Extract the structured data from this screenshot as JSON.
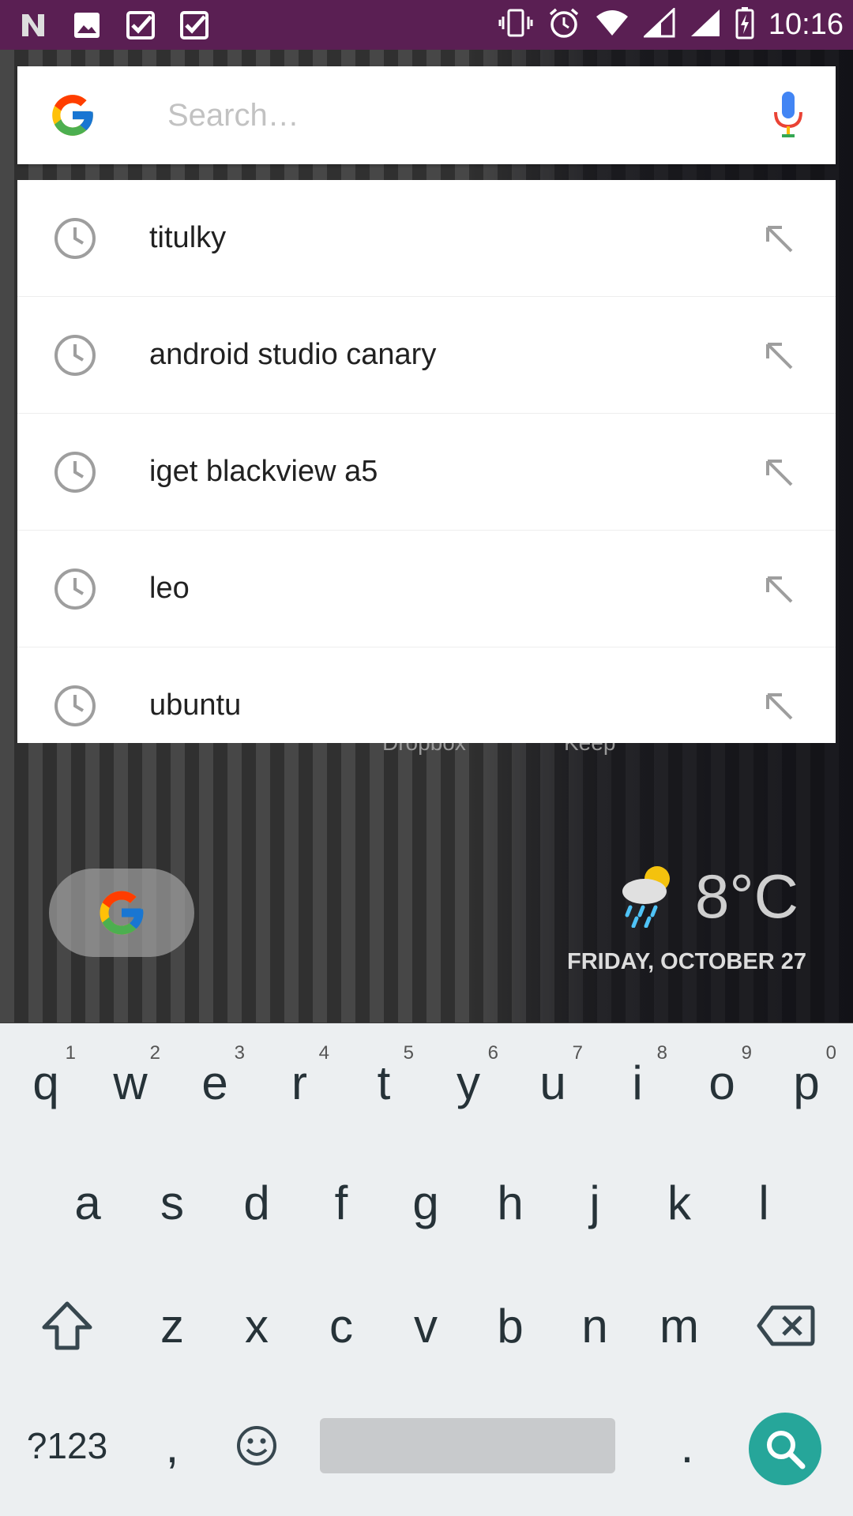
{
  "status_bar": {
    "time": "10:16",
    "left_icons": [
      "notification-n-icon",
      "image-icon",
      "checkbox-icon",
      "checkbox-icon"
    ],
    "right_icons": [
      "vibrate-icon",
      "alarm-icon",
      "wifi-icon",
      "signal-icon",
      "signal-icon",
      "battery-charging-icon"
    ]
  },
  "search": {
    "placeholder": "Search…",
    "value": ""
  },
  "suggestions": [
    {
      "text": "titulky"
    },
    {
      "text": "android studio canary"
    },
    {
      "text": "iget blackview a5"
    },
    {
      "text": "leo"
    },
    {
      "text": "ubuntu"
    }
  ],
  "home": {
    "dock_labels": [
      "Dropbox",
      "Keep"
    ],
    "weather": {
      "temperature": "8°C",
      "icon": "rain-cloud-icon"
    },
    "date": "FRIDAY, OCTOBER 27"
  },
  "keyboard": {
    "row1": [
      {
        "key": "q",
        "hint": "1"
      },
      {
        "key": "w",
        "hint": "2"
      },
      {
        "key": "e",
        "hint": "3"
      },
      {
        "key": "r",
        "hint": "4"
      },
      {
        "key": "t",
        "hint": "5"
      },
      {
        "key": "y",
        "hint": "6"
      },
      {
        "key": "u",
        "hint": "7"
      },
      {
        "key": "i",
        "hint": "8"
      },
      {
        "key": "o",
        "hint": "9"
      },
      {
        "key": "p",
        "hint": "0"
      }
    ],
    "row2": [
      "a",
      "s",
      "d",
      "f",
      "g",
      "h",
      "j",
      "k",
      "l"
    ],
    "row3": [
      "z",
      "x",
      "c",
      "v",
      "b",
      "n",
      "m"
    ],
    "symbols_label": "?123",
    "comma_label": ",",
    "period_label": "."
  },
  "colors": {
    "status_bar": "#5a1f53",
    "search_key": "#26a69a"
  }
}
